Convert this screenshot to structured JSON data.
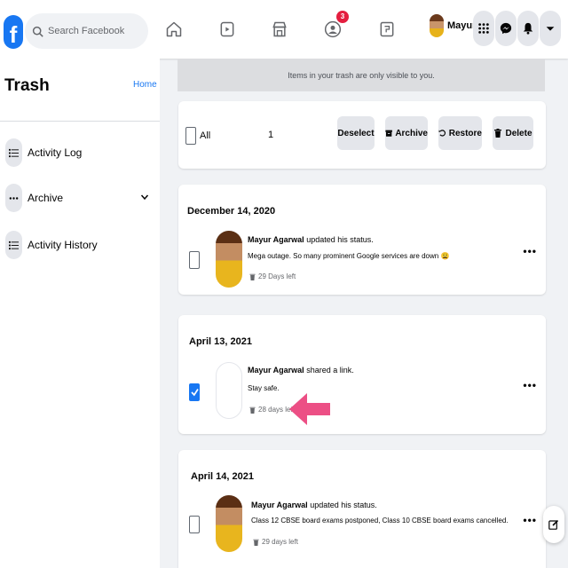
{
  "topbar": {
    "logo": "f",
    "search_placeholder": "Search Facebook",
    "notification_badge": "3",
    "profile_name": "Mayur",
    "nav_icons": [
      "home-icon",
      "watch-icon",
      "marketplace-icon",
      "groups-icon",
      "gaming-icon"
    ],
    "action_icons": [
      "menu-grid-icon",
      "messenger-icon",
      "bell-icon",
      "account-dropdown-icon"
    ]
  },
  "sidebar": {
    "title": "Trash",
    "home_link": "Home",
    "items": [
      {
        "label": "Activity Log",
        "icon": "list-icon"
      },
      {
        "label": "Archive",
        "icon": "more-dots-icon"
      },
      {
        "label": "Activity History",
        "icon": "list-icon"
      }
    ]
  },
  "notice": "Items in your trash are only visible to you.",
  "toolbar": {
    "all_label": "All",
    "selected_count": "1",
    "deselect": "Deselect",
    "archive": "Archive",
    "restore": "Restore",
    "delete": "Delete"
  },
  "posts": [
    {
      "date": "December 14, 2020",
      "author": "Mayur Agarwal",
      "action": " updated his status.",
      "text": "Mega outage. So many prominent Google services are down 😩",
      "days_left": "29 Days left",
      "checked": false
    },
    {
      "date": "April 13, 2021",
      "author": "Mayur Agarwal",
      "action": " shared a link.",
      "text": "Stay safe.",
      "days_left": "28 days left",
      "checked": true
    },
    {
      "date": "April 14, 2021",
      "author": "Mayur Agarwal",
      "action": " updated his status.",
      "text": "Class 12 CBSE board exams postponed, Class 10 CBSE board exams cancelled.",
      "days_left": "29 days left",
      "checked": false
    }
  ],
  "colors": {
    "brand": "#1877f2",
    "badge": "#e41e3f",
    "arrow": "#ec4f85",
    "page_bg": "#f0f2f5"
  }
}
